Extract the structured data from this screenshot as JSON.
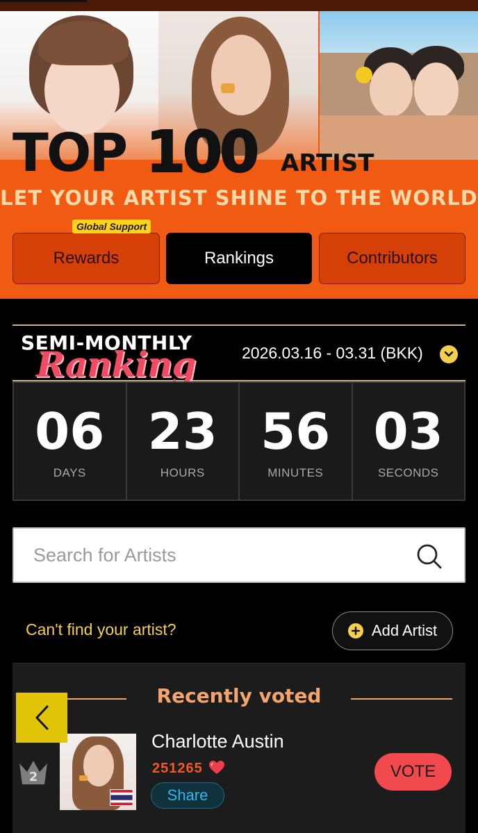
{
  "banner": {
    "title_top": "TOP",
    "title_number": "100",
    "title_artist": "ARTIST",
    "slogan": "LET YOUR ARTIST SHINE TO THE WORLD",
    "badge": "Global Support"
  },
  "tabs": [
    {
      "label": "Rewards",
      "active": false
    },
    {
      "label": "Rankings",
      "active": true
    },
    {
      "label": "Contributors",
      "active": false
    }
  ],
  "ranking": {
    "heading_line1": "SEMI-MONTHLY",
    "heading_line2": "Ranking",
    "date_range": "2026.03.16 - 03.31 (BKK)",
    "dropdown_icon": "chevron-down-icon"
  },
  "countdown": [
    {
      "value": "06",
      "label": "DAYS"
    },
    {
      "value": "23",
      "label": "HOURS"
    },
    {
      "value": "56",
      "label": "MINUTES"
    },
    {
      "value": "03",
      "label": "SECONDS"
    }
  ],
  "search": {
    "placeholder": "Search for Artists",
    "value": "",
    "icon": "search-icon"
  },
  "add_artist": {
    "prompt": "Can't find your artist?",
    "button_label": "Add Artist"
  },
  "recently_voted": {
    "title": "Recently voted",
    "items": [
      {
        "rank": "2",
        "name": "Charlotte Austin",
        "votes": "251265",
        "share_label": "Share",
        "vote_label": "VOTE",
        "flag": "thailand-flag"
      }
    ]
  },
  "colors": {
    "brand_orange": "#f05a12",
    "accent_yellow": "#f6d14a",
    "vote_red": "#f2494f",
    "share_blue": "#2fb9ea"
  }
}
